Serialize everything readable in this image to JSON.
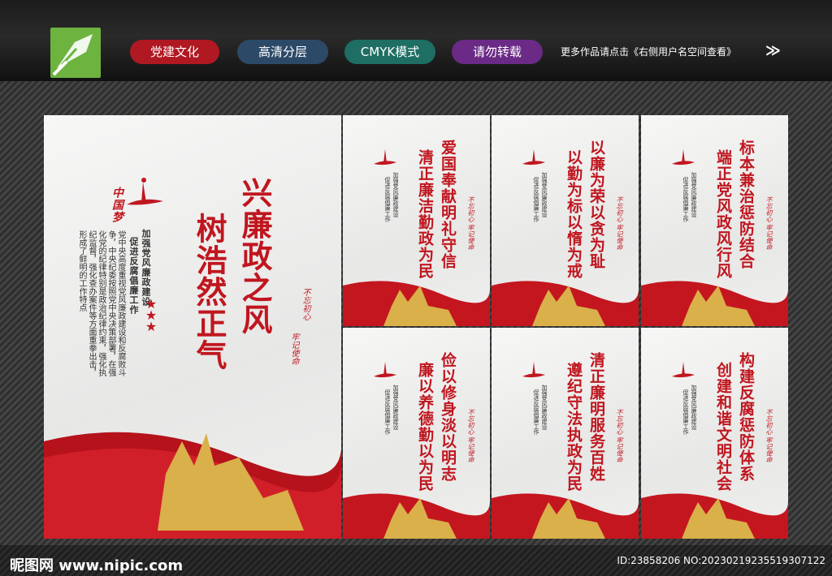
{
  "header": {
    "tags": [
      {
        "label": "党建文化",
        "color": "#b01822"
      },
      {
        "label": "高清分层",
        "color": "#2c4a68"
      },
      {
        "label": "CMYK模式",
        "color": "#1e6e63"
      },
      {
        "label": "请勿转载",
        "color": "#6a2a86"
      }
    ],
    "more_text": "更多作品请点击《右侧用户名空间查看》",
    "arrows": "≫"
  },
  "main_board": {
    "title_line1": "兴廉政之风",
    "title_line2": "树浩然正气",
    "logo_text": "中国梦",
    "subtitle_a": "加强党风廉政建设",
    "subtitle_b": "促进反腐倡廉工作",
    "body": "党中央高度重视党风廉政建设和反腐败斗争，中央纪委按照党中央决策部署，在强化党的纪律特别是政治纪律约束，强化执纪监督，强化查办案件等方面重拳出击，形成了鲜明的工作特点",
    "stamp_a": "不忘初心",
    "stamp_b": "牢记使命"
  },
  "small_boards": [
    {
      "line1": "爱国奉献明礼守信",
      "line2": "清正廉洁勤政为民"
    },
    {
      "line1": "以廉为荣以贪为耻",
      "line2": "以勤为标以惰为戒"
    },
    {
      "line1": "标本兼治惩防结合",
      "line2": "端正党风政风行风"
    },
    {
      "line1": "俭以修身淡以明志",
      "line2": "廉以养德勤以为民"
    },
    {
      "line1": "清正廉明服务百姓",
      "line2": "遵纪守法执政为民"
    },
    {
      "line1": "构建反腐惩防体系",
      "line2": "创建和谐文明社会"
    }
  ],
  "small_board_common": {
    "logo_text": "中国梦",
    "sub_a": "加强党风廉政建设",
    "sub_b": "促进反腐倡廉工作",
    "stamp": "不忘初心 牢记使命"
  },
  "footer": {
    "site": "昵图网 www.nipic.com",
    "id": "ID:23858206 NO:20230219235519307122"
  },
  "colors": {
    "accent_red": "#c0161f",
    "gold": "#d9b04a"
  }
}
